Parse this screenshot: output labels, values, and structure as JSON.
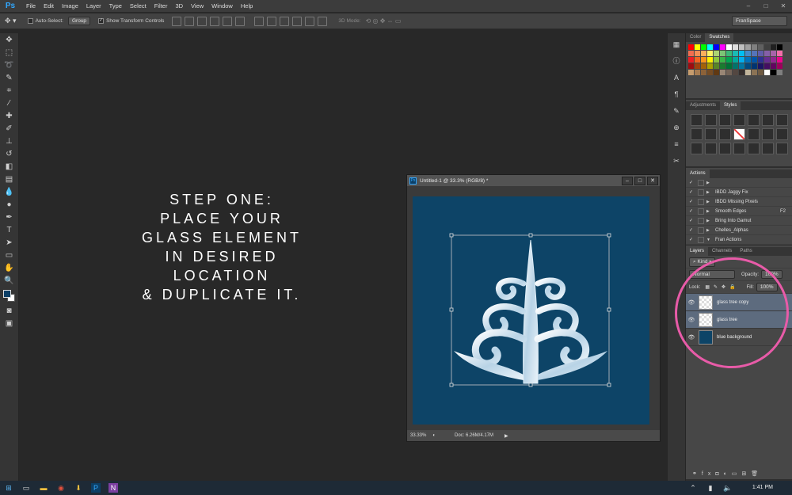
{
  "app": {
    "logo": "Ps",
    "menus": [
      "File",
      "Edit",
      "Image",
      "Layer",
      "Type",
      "Select",
      "Filter",
      "3D",
      "View",
      "Window",
      "Help"
    ]
  },
  "options_bar": {
    "auto_select_label": "Auto-Select:",
    "auto_select_checked": false,
    "group_select": "Group",
    "transform_label": "Show Transform Controls",
    "transform_checked": true,
    "mode_3d_label": "3D Mode:",
    "workspace": "FranSpace"
  },
  "step_text": {
    "lines": [
      "STEP ONE:",
      "PLACE YOUR",
      "GLASS ELEMENT",
      "IN DESIRED",
      "LOCATION",
      "& DUPLICATE IT."
    ]
  },
  "document": {
    "title": "Untitled-1 @ 33.3% (RGB/8) *",
    "zoom": "33.33%",
    "doc_info": "Doc: 6.26M/4.17M",
    "canvas_color": "#0d4467"
  },
  "panels": {
    "color_tabs": [
      "Color",
      "Swatches"
    ],
    "adjustments_tabs": [
      "Adjustments",
      "Styles"
    ],
    "actions_tab": "Actions",
    "actions": [
      {
        "label": "",
        "key": ""
      },
      {
        "label": "IBDD Jaggy Fix",
        "key": ""
      },
      {
        "label": "IBDD Missing Pixels",
        "key": ""
      },
      {
        "label": "Smooth Edges",
        "key": "F2"
      },
      {
        "label": "Bring Into Gamut",
        "key": ""
      },
      {
        "label": "Chelles_Alphas",
        "key": ""
      },
      {
        "label": "Fran Actions",
        "key": ""
      }
    ],
    "layers_tabs": [
      "Layers",
      "Channels",
      "Paths"
    ],
    "kind_label": "Kind",
    "blend_mode": "Normal",
    "opacity_label": "Opacity:",
    "opacity_value": "100%",
    "lock_label": "Lock:",
    "fill_label": "Fill:",
    "fill_value": "100%",
    "layers": [
      {
        "name": "glass tree copy",
        "selected": true,
        "thumb": "check"
      },
      {
        "name": "glass tree",
        "selected": true,
        "thumb": "check"
      },
      {
        "name": "blue background",
        "selected": false,
        "thumb": "blue"
      }
    ]
  },
  "taskbar": {
    "time": "1:41 PM"
  },
  "colors": {
    "highlight": "#e85ba8",
    "ps_blue": "#31a8ff"
  }
}
